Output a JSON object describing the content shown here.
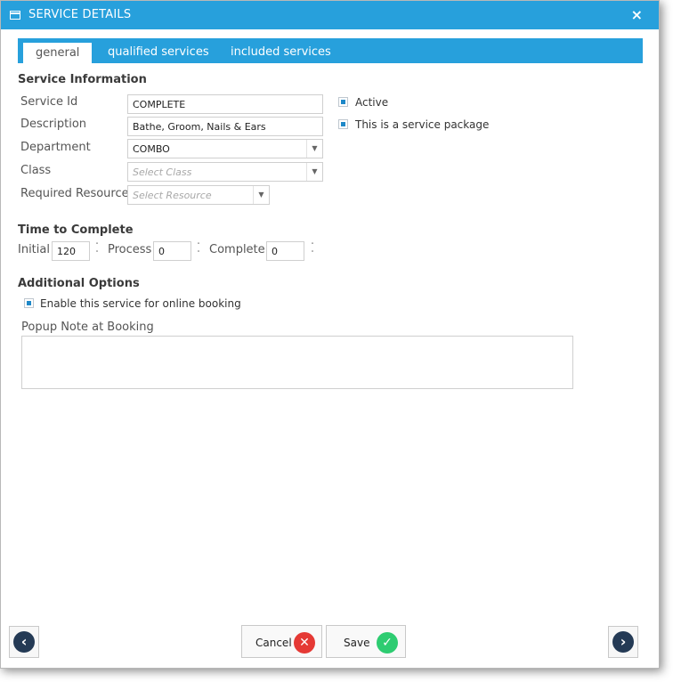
{
  "window": {
    "title": "SERVICE DETAILS",
    "close_symbol": "×"
  },
  "tabs": [
    {
      "label": "general",
      "active": true
    },
    {
      "label": "qualified services",
      "active": false
    },
    {
      "label": "included services",
      "active": false
    }
  ],
  "service_info": {
    "heading": "Service Information",
    "service_id": {
      "label": "Service Id",
      "value": "COMPLETE"
    },
    "description": {
      "label": "Description",
      "value": "Bathe, Groom, Nails & Ears"
    },
    "department": {
      "label": "Department",
      "value": "COMBO"
    },
    "class": {
      "label": "Class",
      "placeholder": "Select Class"
    },
    "required_resource": {
      "label": "Required Resource",
      "placeholder": "Select Resource"
    },
    "active": {
      "label": "Active",
      "checked": true
    },
    "service_package": {
      "label": "This is a service package",
      "checked": true
    }
  },
  "time_to_complete": {
    "heading": "Time to Complete",
    "initial": {
      "label": "Initial",
      "value": "120"
    },
    "process": {
      "label": "Process",
      "value": "0"
    },
    "complete": {
      "label": "Complete",
      "value": "0"
    }
  },
  "additional_options": {
    "heading": "Additional Options",
    "online_booking": {
      "label": "Enable this service for online booking",
      "checked": true
    },
    "popup_note": {
      "label": "Popup Note at Booking",
      "value": ""
    }
  },
  "footer": {
    "cancel_label": "Cancel",
    "save_label": "Save"
  },
  "colors": {
    "accent": "#27a0dc",
    "cancel": "#e53935",
    "save": "#2ecc71",
    "nav": "#243a55"
  },
  "icons": {
    "window": "window-icon",
    "close": "close-icon",
    "cancel": "cancel-icon",
    "save": "check-icon",
    "prev": "arrow-left-icon",
    "next": "arrow-right-icon"
  }
}
